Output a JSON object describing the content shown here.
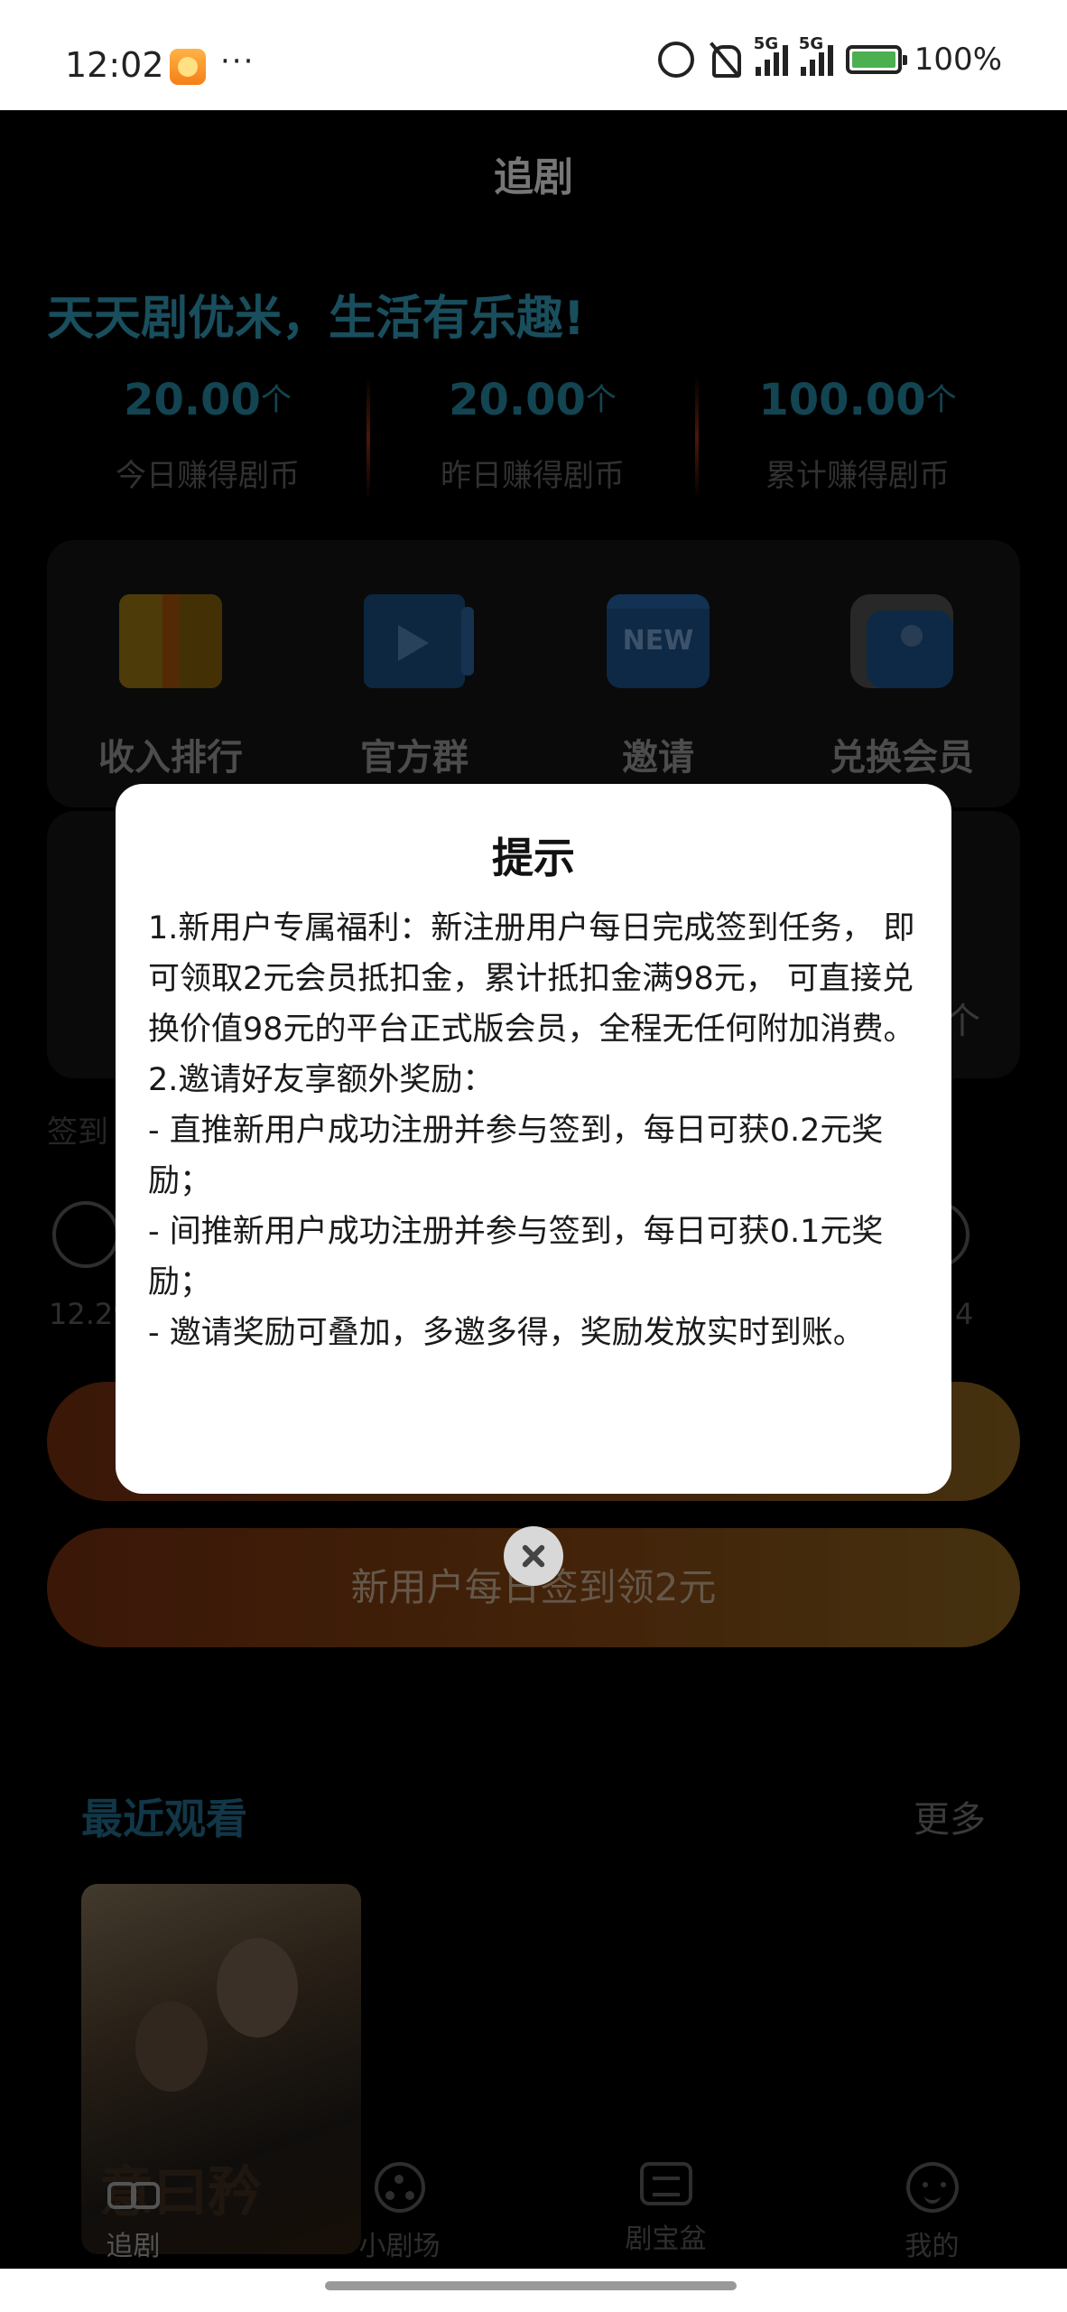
{
  "status_bar": {
    "time": "12:02",
    "more": "···",
    "network_1": "5G",
    "network_2": "5G",
    "battery": "100%"
  },
  "header": {
    "title": "追剧",
    "slogan": "天天剧优米，生活有乐趣!"
  },
  "stats": [
    {
      "value": "20.00",
      "unit": "个",
      "label": "今日赚得剧币"
    },
    {
      "value": "20.00",
      "unit": "个",
      "label": "昨日赚得剧币"
    },
    {
      "value": "100.00",
      "unit": "个",
      "label": "累计赚得剧币"
    }
  ],
  "quick_entries": [
    {
      "label": "收入排行",
      "icon": "income-rank-icon"
    },
    {
      "label": "官方群",
      "icon": "official-group-icon"
    },
    {
      "label": "邀请",
      "icon": "invite-new-icon",
      "badge": "NEW"
    },
    {
      "label": "兑换会员",
      "icon": "exchange-vip-icon"
    }
  ],
  "card2": {
    "unit_text": "个"
  },
  "sign_in": {
    "label": "签到",
    "start_date": "12.29",
    "end_date": "4"
  },
  "buttons": {
    "primary_label": "",
    "new_user_label": "新用户每日签到领2元"
  },
  "recent": {
    "title": "最近观看",
    "more": "更多",
    "poster_title": "意曰矜"
  },
  "nav": [
    {
      "label": "追剧",
      "icon": "glasses-icon",
      "active": true
    },
    {
      "label": "小剧场",
      "icon": "film-reel-icon",
      "active": false
    },
    {
      "label": "剧宝盆",
      "icon": "treasure-box-icon",
      "active": false
    },
    {
      "label": "我的",
      "icon": "profile-face-icon",
      "active": false
    }
  ],
  "dialog": {
    "title": "提示",
    "lines": [
      "1.新用户专属福利：新注册用户每日完成签到任务， 即可领取2元会员抵扣金，累计抵扣金满98元， 可直接兑换价值98元的平台正式版会员，全程无任何附加消费。",
      "2.邀请好友享额外奖励：",
      "- 直推新用户成功注册并参与签到，每日可获0.2元奖励；",
      "- 间推新用户成功注册并参与签到，每日可获0.1元奖励；",
      "- 邀请奖励可叠加，多邀多得，奖励发放实时到账。"
    ]
  },
  "colors": {
    "accent_teal": "#2e8faa",
    "button_orange": "#c8702a",
    "background": "#000000"
  }
}
